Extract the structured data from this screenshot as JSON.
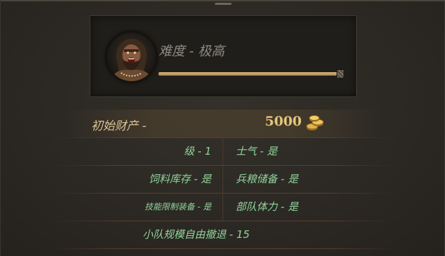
{
  "difficulty": {
    "label": "难度 - 极高",
    "level": 1.0,
    "portrait_icon": "barbarian-portrait-icon"
  },
  "funds": {
    "label": "初始财产 -",
    "value": "5000",
    "icon": "gold-coins-icon"
  },
  "settings": {
    "level": "级 - 1",
    "morale": "士气 - 是",
    "fodder": "饲料库存 - 是",
    "rations": "兵粮储备 - 是",
    "equipment": "技能限制装备 - 是",
    "stamina": "部队体力 - 是",
    "retreat": "小队规模自由撤退 - 15"
  },
  "colors": {
    "accent_green": "#8fd39a",
    "gold": "#e6c57c",
    "muted_text": "#8e8982"
  }
}
